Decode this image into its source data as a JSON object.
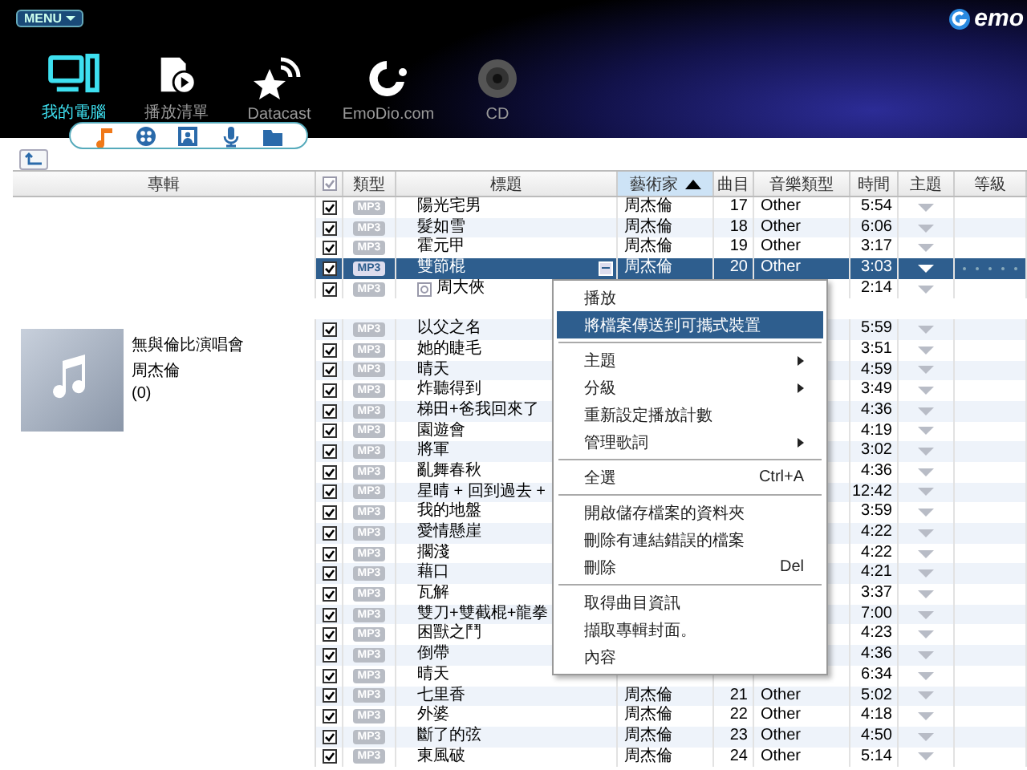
{
  "menu_button": {
    "label": "MENU"
  },
  "logo": {
    "text": "emo"
  },
  "nav": [
    {
      "kind": "computer",
      "label": "我的電腦",
      "selected": true
    },
    {
      "kind": "playlist",
      "label": "播放清單",
      "selected": false
    },
    {
      "kind": "datacast",
      "label": "Datacast",
      "selected": false
    },
    {
      "kind": "site",
      "label": "EmoDio.com",
      "selected": false
    },
    {
      "kind": "cd",
      "label": "CD",
      "selected": false
    }
  ],
  "media_tabs": [
    {
      "kind": "music",
      "selected": true
    },
    {
      "kind": "video",
      "selected": false
    },
    {
      "kind": "photo",
      "selected": false
    },
    {
      "kind": "voice",
      "selected": false
    },
    {
      "kind": "folder",
      "selected": false
    }
  ],
  "table": {
    "all_checked": true,
    "columns": [
      {
        "kind": "album",
        "label": "專輯",
        "sorted": false
      },
      {
        "kind": "check",
        "sorted": false
      },
      {
        "kind": "type",
        "label": "類型",
        "sorted": false
      },
      {
        "kind": "title",
        "label": "標題",
        "sorted": false
      },
      {
        "kind": "artist",
        "label": "藝術家",
        "sorted": true
      },
      {
        "kind": "track",
        "label": "曲目",
        "sorted": false
      },
      {
        "kind": "genre",
        "label": "音樂類型",
        "sorted": false
      },
      {
        "kind": "time",
        "label": "時間",
        "sorted": false
      },
      {
        "kind": "theme",
        "label": "主題",
        "sorted": false
      },
      {
        "kind": "rating",
        "label": "等級",
        "sorted": false
      }
    ],
    "groups": [
      {
        "rows": [
          {
            "checked": true,
            "type": "MP3",
            "title": "陽光宅男",
            "artist": "周杰倫",
            "track": "17",
            "genre": "Other",
            "time": "5:54",
            "selected": false,
            "has_icon": false
          },
          {
            "checked": true,
            "type": "MP3",
            "title": "髮如雪",
            "artist": "周杰倫",
            "track": "18",
            "genre": "Other",
            "time": "6:06",
            "selected": false,
            "has_icon": false
          },
          {
            "checked": true,
            "type": "MP3",
            "title": "霍元甲",
            "artist": "周杰倫",
            "track": "19",
            "genre": "Other",
            "time": "3:17",
            "selected": false,
            "has_icon": false
          },
          {
            "checked": true,
            "type": "MP3",
            "title": "雙節棍",
            "artist": "周杰倫",
            "track": "20",
            "genre": "Other",
            "time": "3:03",
            "selected": true,
            "has_icon": false
          },
          {
            "checked": true,
            "type": "MP3",
            "title": "周大俠",
            "time": "2:14",
            "selected": false,
            "has_icon": true
          }
        ]
      },
      {
        "album": {
          "name": "無與倫比演唱會",
          "artist": "周杰倫",
          "count": "(0)"
        },
        "rows": [
          {
            "checked": true,
            "type": "MP3",
            "title": "以父之名",
            "time": "5:59",
            "selected": false,
            "has_icon": false
          },
          {
            "checked": true,
            "type": "MP3",
            "title": "她的睫毛",
            "time": "3:51",
            "selected": false,
            "has_icon": false
          },
          {
            "checked": true,
            "type": "MP3",
            "title": "晴天",
            "time": "4:59",
            "selected": false,
            "has_icon": false
          },
          {
            "checked": true,
            "type": "MP3",
            "title": "炸聽得到",
            "time": "3:49",
            "selected": false,
            "has_icon": false
          },
          {
            "checked": true,
            "type": "MP3",
            "title": "梯田+爸我回來了",
            "time": "4:36",
            "selected": false,
            "has_icon": false
          },
          {
            "checked": true,
            "type": "MP3",
            "title": "園遊會",
            "time": "4:19",
            "selected": false,
            "has_icon": false
          },
          {
            "checked": true,
            "type": "MP3",
            "title": "將軍",
            "time": "3:02",
            "selected": false,
            "has_icon": false
          },
          {
            "checked": true,
            "type": "MP3",
            "title": "亂舞春秋",
            "time": "4:36",
            "selected": false,
            "has_icon": false
          },
          {
            "checked": true,
            "type": "MP3",
            "title": "星晴 + 回到過去 +",
            "time": "12:42",
            "selected": false,
            "has_icon": false
          },
          {
            "checked": true,
            "type": "MP3",
            "title": "我的地盤",
            "time": "3:59",
            "selected": false,
            "has_icon": false
          },
          {
            "checked": true,
            "type": "MP3",
            "title": "愛情懸崖",
            "time": "4:22",
            "selected": false,
            "has_icon": false
          },
          {
            "checked": true,
            "type": "MP3",
            "title": "擱淺",
            "time": "4:22",
            "selected": false,
            "has_icon": false
          },
          {
            "checked": true,
            "type": "MP3",
            "title": "藉口",
            "time": "4:21",
            "selected": false,
            "has_icon": false
          },
          {
            "checked": true,
            "type": "MP3",
            "title": "瓦解",
            "time": "3:37",
            "selected": false,
            "has_icon": false
          },
          {
            "checked": true,
            "type": "MP3",
            "title": "雙刀+雙截棍+龍拳",
            "time": "7:00",
            "selected": false,
            "has_icon": false
          },
          {
            "checked": true,
            "type": "MP3",
            "title": "困獸之鬥",
            "time": "4:23",
            "selected": false,
            "has_icon": false
          },
          {
            "checked": true,
            "type": "MP3",
            "title": "倒帶",
            "time": "4:36",
            "selected": false,
            "has_icon": false
          },
          {
            "checked": true,
            "type": "MP3",
            "title": "晴天",
            "time": "6:34",
            "selected": false,
            "has_icon": false
          },
          {
            "checked": true,
            "type": "MP3",
            "title": "七里香",
            "artist": "周杰倫",
            "track": "21",
            "genre": "Other",
            "time": "5:02",
            "selected": false,
            "has_icon": false
          },
          {
            "checked": true,
            "type": "MP3",
            "title": "外婆",
            "artist": "周杰倫",
            "track": "22",
            "genre": "Other",
            "time": "4:18",
            "selected": false,
            "has_icon": false
          },
          {
            "checked": true,
            "type": "MP3",
            "title": "斷了的弦",
            "artist": "周杰倫",
            "track": "23",
            "genre": "Other",
            "time": "4:50",
            "selected": false,
            "has_icon": false
          },
          {
            "checked": true,
            "type": "MP3",
            "title": "東風破",
            "artist": "周杰倫",
            "track": "24",
            "genre": "Other",
            "time": "5:14",
            "selected": false,
            "has_icon": false
          }
        ]
      }
    ]
  },
  "context_menu": [
    {
      "kind": "item",
      "label": "播放",
      "highlighted": false,
      "submenu": false
    },
    {
      "kind": "item",
      "label": "將檔案傳送到可攜式裝置",
      "highlighted": true,
      "submenu": false
    },
    {
      "kind": "separator"
    },
    {
      "kind": "item",
      "label": "主題",
      "highlighted": false,
      "submenu": true
    },
    {
      "kind": "item",
      "label": "分級",
      "highlighted": false,
      "submenu": true
    },
    {
      "kind": "item",
      "label": "重新設定播放計數",
      "highlighted": false,
      "submenu": false
    },
    {
      "kind": "item",
      "label": "管理歌詞",
      "highlighted": false,
      "submenu": true
    },
    {
      "kind": "separator"
    },
    {
      "kind": "item",
      "label": "全選",
      "shortcut": "Ctrl+A",
      "highlighted": false,
      "submenu": false
    },
    {
      "kind": "separator"
    },
    {
      "kind": "item",
      "label": "開啟儲存檔案的資料夾",
      "highlighted": false,
      "submenu": false
    },
    {
      "kind": "item",
      "label": "刪除有連結錯誤的檔案",
      "highlighted": false,
      "submenu": false
    },
    {
      "kind": "item",
      "label": "刪除",
      "shortcut": "Del",
      "highlighted": false,
      "submenu": false
    },
    {
      "kind": "separator"
    },
    {
      "kind": "item",
      "label": "取得曲目資訊",
      "highlighted": false,
      "submenu": false
    },
    {
      "kind": "item",
      "label": "擷取專輯封面。",
      "highlighted": false,
      "submenu": false
    },
    {
      "kind": "item",
      "label": "內容",
      "highlighted": false,
      "submenu": false
    }
  ]
}
